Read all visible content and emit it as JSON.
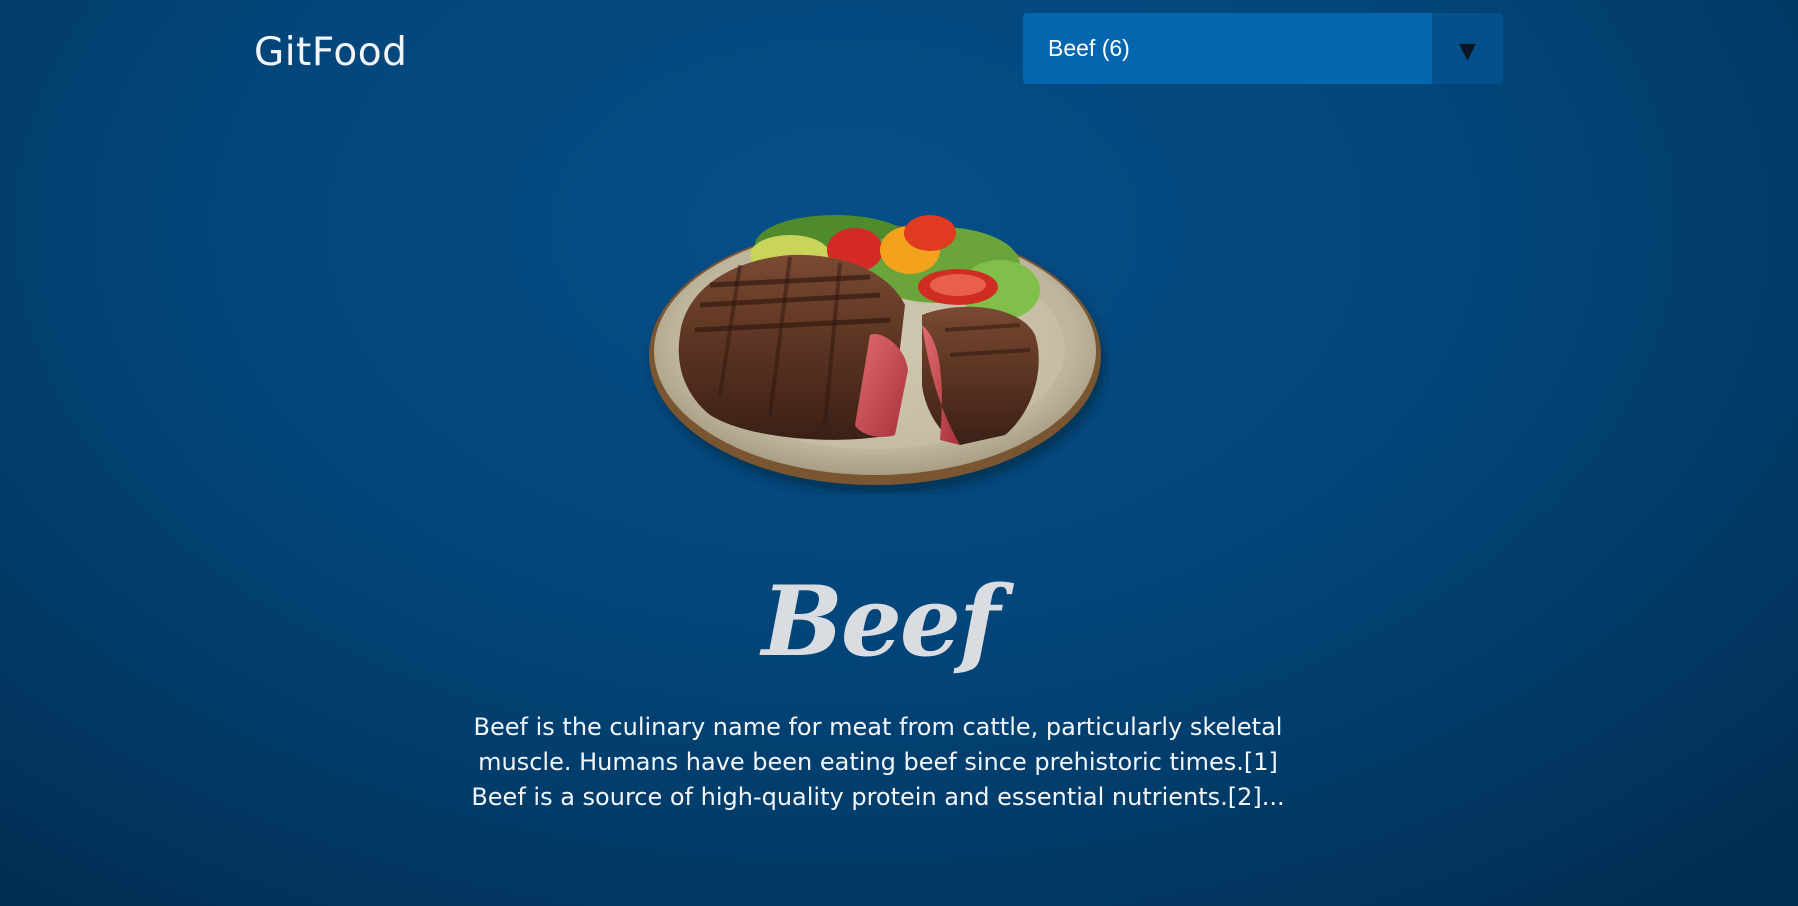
{
  "header": {
    "brand": "GitFood"
  },
  "category_select": {
    "selected": "Beef (6)",
    "arrow_icon": "dropdown-triangle-icon"
  },
  "category": {
    "image_icon": "beef-steak-plate-image",
    "name": "Beef",
    "description": "Beef is the culinary name for meat from cattle, particularly skeletal muscle. Humans have been eating beef since prehistoric times.[1] Beef is a source of high-quality protein and essential nutrients.[2]..."
  },
  "colors": {
    "background": "#03467b",
    "select": "#0566b0",
    "select_arrow_bg": "#04508c",
    "title": "#d9dde2"
  }
}
